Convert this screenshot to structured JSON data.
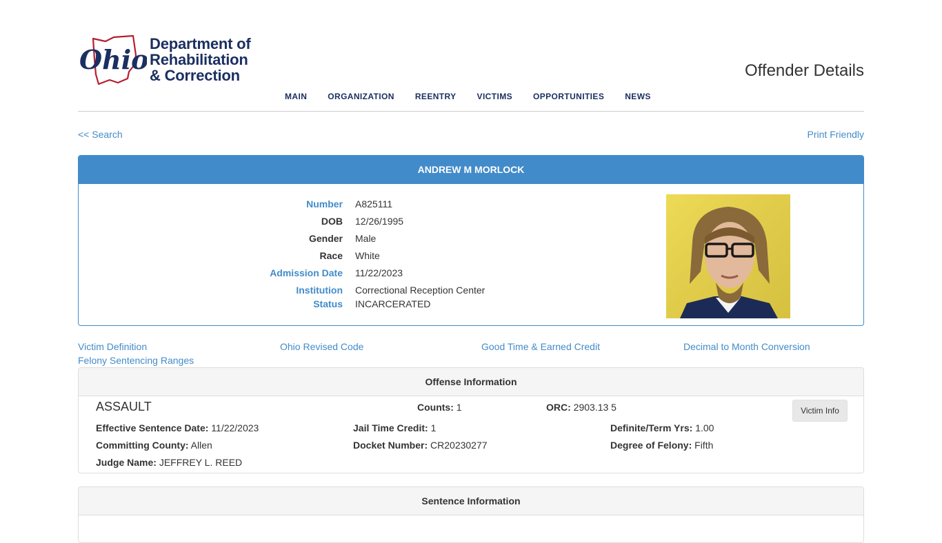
{
  "header": {
    "logo_line1": "Department of",
    "logo_line2": "Rehabilitation",
    "logo_line3": "& Correction",
    "page_title": "Offender Details",
    "nav": [
      "MAIN",
      "ORGANIZATION",
      "REENTRY",
      "VICTIMS",
      "OPPORTUNITIES",
      "NEWS"
    ]
  },
  "links": {
    "search": "<< Search",
    "print": "Print Friendly"
  },
  "offender": {
    "name": "ANDREW M MORLOCK",
    "fields": [
      {
        "label": "Number",
        "value": "A825111"
      },
      {
        "label": "DOB",
        "value": "12/26/1995"
      },
      {
        "label": "Gender",
        "value": "Male"
      },
      {
        "label": "Race",
        "value": "White"
      },
      {
        "label": "Admission Date",
        "value": "11/22/2023"
      },
      {
        "label": "Institution",
        "value": "Correctional Reception Center"
      },
      {
        "label": "Status",
        "value": "INCARCERATED"
      }
    ]
  },
  "quick_links": [
    "Victim Definition",
    "Ohio Revised Code",
    "Good Time & Earned Credit",
    "Decimal to Month Conversion",
    "Felony Sentencing Ranges"
  ],
  "offense": {
    "heading": "Offense Information",
    "crime": "ASSAULT",
    "counts_label": "Counts:",
    "counts": "1",
    "orc_label": "ORC:",
    "orc": "2903.13 5",
    "victim_button": "Victim Info",
    "effective_label": "Effective Sentence Date:",
    "effective": "11/22/2023",
    "jail_label": "Jail Time Credit:",
    "jail": "1",
    "definite_label": "Definite/Term Yrs:",
    "definite": "1.00",
    "county_label": "Committing County:",
    "county": "Allen",
    "docket_label": "Docket Number:",
    "docket": "CR20230277",
    "degree_label": "Degree of Felony:",
    "degree": "Fifth",
    "judge_label": "Judge Name:",
    "judge": "JEFFREY L. REED"
  },
  "sentence": {
    "heading": "Sentence Information"
  },
  "colors": {
    "brand_navy": "#1b2f60",
    "ohio_red": "#b51f2e",
    "link_blue": "#428bca"
  }
}
